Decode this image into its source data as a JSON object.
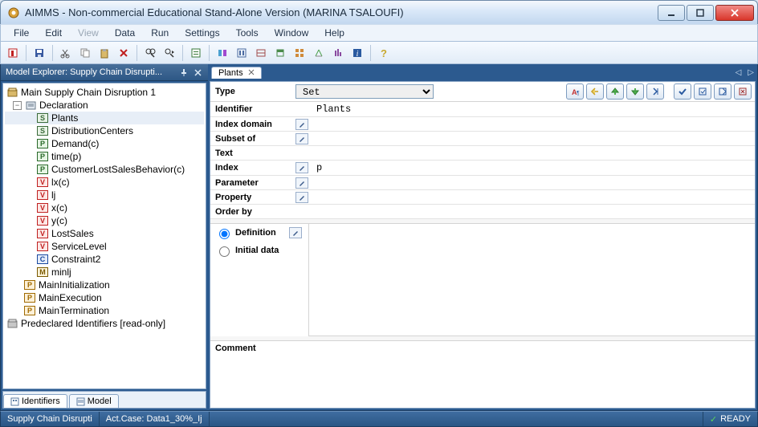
{
  "window": {
    "title": "AIMMS - Non-commercial Educational Stand-Alone Version (MARINA TSALOUFI)"
  },
  "menu": {
    "file": "File",
    "edit": "Edit",
    "view": "View",
    "data": "Data",
    "run": "Run",
    "settings": "Settings",
    "tools": "Tools",
    "window": "Window",
    "help": "Help"
  },
  "explorer": {
    "title": "Model Explorer: Supply Chain Disrupti...",
    "root": "Main Supply Chain Disruption 1",
    "declaration": "Declaration",
    "items": [
      {
        "icon": "S",
        "label": "Plants",
        "selected": true
      },
      {
        "icon": "S",
        "label": "DistributionCenters"
      },
      {
        "icon": "P",
        "label": "Demand(c)"
      },
      {
        "icon": "P",
        "label": "time(p)"
      },
      {
        "icon": "P",
        "label": "CustomerLostSalesBehavior(c)"
      },
      {
        "icon": "V",
        "label": "lx(c)"
      },
      {
        "icon": "V",
        "label": "lj"
      },
      {
        "icon": "V",
        "label": "x(c)"
      },
      {
        "icon": "V",
        "label": "y(c)"
      },
      {
        "icon": "V",
        "label": "LostSales"
      },
      {
        "icon": "V",
        "label": "ServiceLevel"
      },
      {
        "icon": "C",
        "label": "Constraint2"
      },
      {
        "icon": "M",
        "label": "minlj"
      }
    ],
    "procs": [
      {
        "label": "MainInitialization"
      },
      {
        "label": "MainExecution"
      },
      {
        "label": "MainTermination"
      }
    ],
    "predeclared": "Predeclared Identifiers [read-only]",
    "bottom_tabs": {
      "identifiers": "Identifiers",
      "model": "Model"
    }
  },
  "doc": {
    "tab": "Plants"
  },
  "props": {
    "type_label": "Type",
    "type_value": "Set",
    "identifier_label": "Identifier",
    "identifier_value": "Plants",
    "index_domain_label": "Index domain",
    "subset_of_label": "Subset of",
    "text_label": "Text",
    "index_label": "Index",
    "index_value": "p",
    "parameter_label": "Parameter",
    "property_label": "Property",
    "order_by_label": "Order by",
    "definition_label": "Definition",
    "initial_data_label": "Initial data",
    "comment_label": "Comment"
  },
  "status": {
    "project": "Supply Chain Disrupti",
    "case": "Act.Case: Data1_30%_Ij",
    "ready": "READY"
  }
}
